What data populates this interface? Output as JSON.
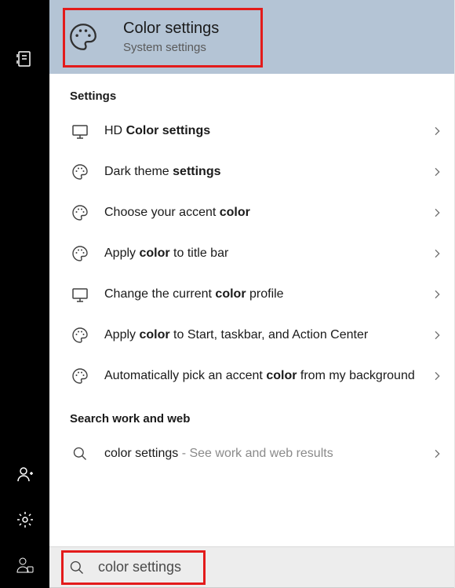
{
  "hero": {
    "title": "Color settings",
    "subtitle": "System settings"
  },
  "section_settings_label": "Settings",
  "results": [
    {
      "icon": "monitor",
      "html": "HD <b>Color settings</b>"
    },
    {
      "icon": "palette",
      "html": "Dark theme <b>settings</b>"
    },
    {
      "icon": "palette",
      "html": "Choose your accent <b>color</b>"
    },
    {
      "icon": "palette",
      "html": "Apply <b>color</b> to title bar"
    },
    {
      "icon": "monitor",
      "html": "Change the current <b>color</b> profile"
    },
    {
      "icon": "palette",
      "html": "Apply <b>color</b> to Start, taskbar, and Action Center"
    },
    {
      "icon": "palette",
      "html": "Automatically pick an accent <b>color</b> from my background"
    }
  ],
  "section_web_label": "Search work and web",
  "web_result": {
    "text": "color settings",
    "hint": " - See work and web results"
  },
  "search_value": "color settings",
  "sidebar": {
    "top_icon": "documents",
    "bottom": [
      "add-user",
      "settings-gear",
      "account"
    ]
  }
}
